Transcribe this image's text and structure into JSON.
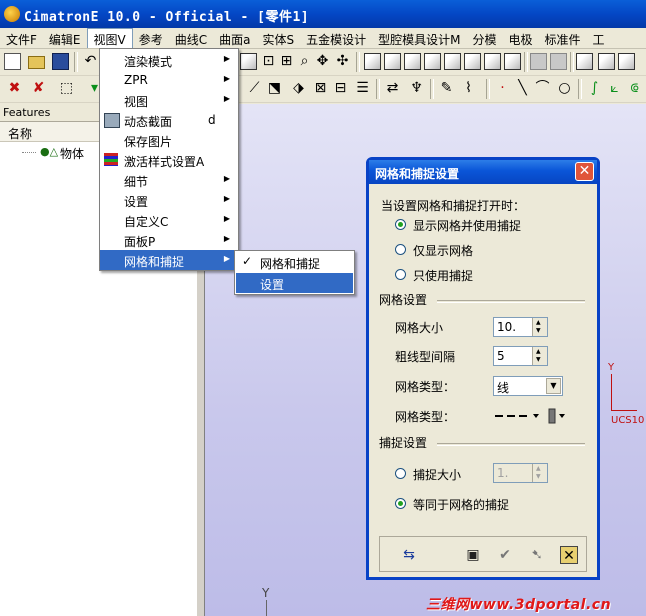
{
  "window": {
    "title": "CimatronE 10.0 - Official - [零件1]"
  },
  "menubar": [
    {
      "label": "文件F"
    },
    {
      "label": "编辑E"
    },
    {
      "label": "视图V"
    },
    {
      "label": "参考"
    },
    {
      "label": "曲线C"
    },
    {
      "label": "曲面a"
    },
    {
      "label": "实体S"
    },
    {
      "label": "五金模设计"
    },
    {
      "label": "型腔模具设计M"
    },
    {
      "label": "分模"
    },
    {
      "label": "电极"
    },
    {
      "label": "标准件"
    },
    {
      "label": "工"
    }
  ],
  "view_menu": {
    "items": [
      {
        "label": "渲染模式"
      },
      {
        "label": "ZPR"
      },
      {
        "label": "视图"
      },
      {
        "label": "动态截面",
        "shortcut": "d"
      },
      {
        "label": "保存图片"
      },
      {
        "label": "激活样式设置A"
      },
      {
        "label": "细节"
      },
      {
        "label": "设置"
      },
      {
        "label": "自定义C"
      },
      {
        "label": "面板P"
      },
      {
        "label": "网格和捕捉"
      }
    ]
  },
  "grid_submenu": {
    "items": [
      {
        "label": "网格和捕捉",
        "checked": "✓"
      },
      {
        "label": "设置"
      }
    ]
  },
  "left_panel": {
    "header": "Features",
    "column": "名称",
    "tree_item": "物体"
  },
  "viewport": {
    "ucs_y": "Y",
    "ucs_label": "UCS10",
    "axis_y": "Y"
  },
  "dialog": {
    "title": "网格和捕捉设置",
    "close": "✕",
    "prompt": "当设置网格和捕捉打开时：",
    "radio1": "显示网格并使用捕捉",
    "radio2": "仅显示网格",
    "radio3": "只使用捕捉",
    "grid_section": "网格设置",
    "grid_size_label": "网格大小",
    "grid_size_value": "10.",
    "thick_interval_label": "粗线型间隔",
    "thick_interval_value": "5",
    "grid_type_label": "网格类型：",
    "grid_type_value": "线",
    "grid_type2_label": "网格类型：",
    "snap_section": "捕捉设置",
    "snap_size_label": "捕捉大小",
    "snap_size_value": "1.",
    "snap_equal_label": "等同于网格的捕捉"
  },
  "watermark": "三维网www.3dportal.cn"
}
